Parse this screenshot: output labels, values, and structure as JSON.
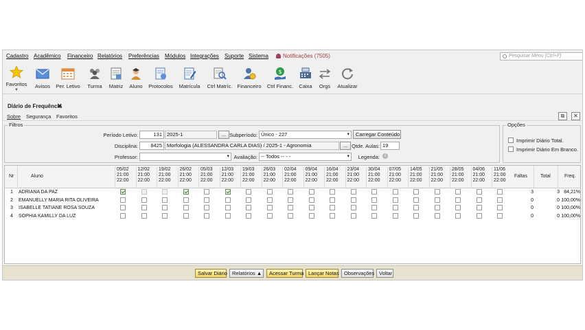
{
  "menu": {
    "items": [
      "Cadastro",
      "Acadêmico",
      "Financeiro",
      "Relatórios",
      "Preferências",
      "Módulos",
      "Integrações",
      "Suporte",
      "Sistema"
    ],
    "notifications": "Notificações (7505)",
    "search_placeholder": "Pesquisar Menu (Ctrl+F)"
  },
  "toolbar": {
    "items": [
      {
        "label": "Favoritos",
        "icon": "star-icon"
      },
      {
        "label": "Avisos",
        "icon": "envelope-icon"
      },
      {
        "label": "Per. Letivo",
        "icon": "calendar-icon"
      },
      {
        "label": "Turma",
        "icon": "group-icon"
      },
      {
        "label": "Matriz",
        "icon": "matrix-icon"
      },
      {
        "label": "Aluno",
        "icon": "student-icon"
      },
      {
        "label": "Protocolos",
        "icon": "protocol-icon"
      },
      {
        "label": "Matrícula",
        "icon": "enrollment-icon"
      },
      {
        "label": "Ctrl Matríc.",
        "icon": "enrollment-search-icon"
      },
      {
        "label": "Financeiro",
        "icon": "finance-user-icon"
      },
      {
        "label": "Ctrl Financ.",
        "icon": "finance-control-icon"
      },
      {
        "label": "Caixa",
        "icon": "cash-register-icon"
      },
      {
        "label": "Orgs",
        "icon": "swap-arrows-icon"
      },
      {
        "label": "Atualizar",
        "icon": "refresh-icon"
      }
    ]
  },
  "panel": {
    "title": "Diário de Frequência",
    "close": "✕",
    "submenu": [
      "Sobre",
      "Segurança",
      "Favoritos"
    ]
  },
  "filters": {
    "legend": "Filtros",
    "periodo_label": "Período Letivo:",
    "periodo_code": "131",
    "periodo_name": "2025-1",
    "subperiodo_label": "Subperíodo:",
    "subperiodo_value": "Único - 227",
    "carregar_label": "Carregar Conteúdo",
    "disciplina_label": "Disciplina:",
    "disciplina_code": "8425",
    "disciplina_name": "Morfologia  (ALESSANDRA CARLA DIAS) / 2025-1 - Agronomia",
    "qtde_label": "Qtde. Aulas:",
    "qtde_value": "19",
    "professor_label": "Professor:",
    "professor_value": "",
    "avaliacao_label": "Avaliação:",
    "avaliacao_value": "-- Todos -- -  -",
    "legenda_label": "Legenda:",
    "ellipsis": "..."
  },
  "options": {
    "legend": "Opções",
    "imprimir_total": "Imprimir Diário Total.",
    "imprimir_branco": "Imprimir Diário Em Branco."
  },
  "grid": {
    "col_nr": "Nr",
    "col_aluno": "Aluno",
    "col_faltas": "Faltas",
    "col_total": "Total",
    "col_freq": "Freq.",
    "dates": [
      "05/02",
      "12/02",
      "19/02",
      "26/02",
      "05/03",
      "12/03",
      "19/03",
      "26/03",
      "02/04",
      "09/04",
      "16/04",
      "23/04",
      "30/04",
      "07/05",
      "14/05",
      "21/05",
      "28/05",
      "04/06",
      "11/06"
    ],
    "time_start": "21:00",
    "time_end": "22:00",
    "rows": [
      {
        "nr": "1",
        "name": "ADRIANA DA PAZ",
        "checks": [
          1,
          0,
          0,
          1,
          0,
          1,
          0,
          0,
          0,
          0,
          0,
          0,
          0,
          0,
          0,
          0,
          0,
          0,
          0
        ],
        "faltas": "3",
        "total": "3",
        "freq": "84,21%"
      },
      {
        "nr": "2",
        "name": "EMANUELLY MARIA RITA OLIVEIRA",
        "checks": [
          0,
          0,
          0,
          0,
          0,
          0,
          0,
          0,
          0,
          0,
          0,
          0,
          0,
          0,
          0,
          0,
          0,
          0,
          0
        ],
        "faltas": "0",
        "total": "0",
        "freq": "100,00%"
      },
      {
        "nr": "3",
        "name": "ISABELLE TATIANE ROSA SOUZA",
        "checks": [
          0,
          0,
          0,
          0,
          0,
          0,
          0,
          0,
          0,
          0,
          0,
          0,
          0,
          0,
          0,
          0,
          0,
          0,
          0
        ],
        "faltas": "0",
        "total": "0",
        "freq": "100,00%"
      },
      {
        "nr": "4",
        "name": "SOPHIA KAMILLY DA LUZ",
        "checks": [
          0,
          0,
          0,
          0,
          0,
          0,
          0,
          0,
          0,
          0,
          0,
          0,
          0,
          0,
          0,
          0,
          0,
          0,
          0
        ],
        "faltas": "0",
        "total": "0",
        "freq": "100,00%"
      }
    ]
  },
  "bottom": {
    "salvar": "Salvar Diário",
    "relatorios": "Relatórios ▲",
    "acessar": "Acessar Turma",
    "lancar": "Lançar Notas",
    "observacoes": "Observações",
    "voltar": "Voltar"
  },
  "colors": {
    "accent_yellow": "#f3d66a",
    "bottom_bar": "#e8e3d0",
    "check_green": "#3a7a2a",
    "notif_red": "#a04040"
  }
}
